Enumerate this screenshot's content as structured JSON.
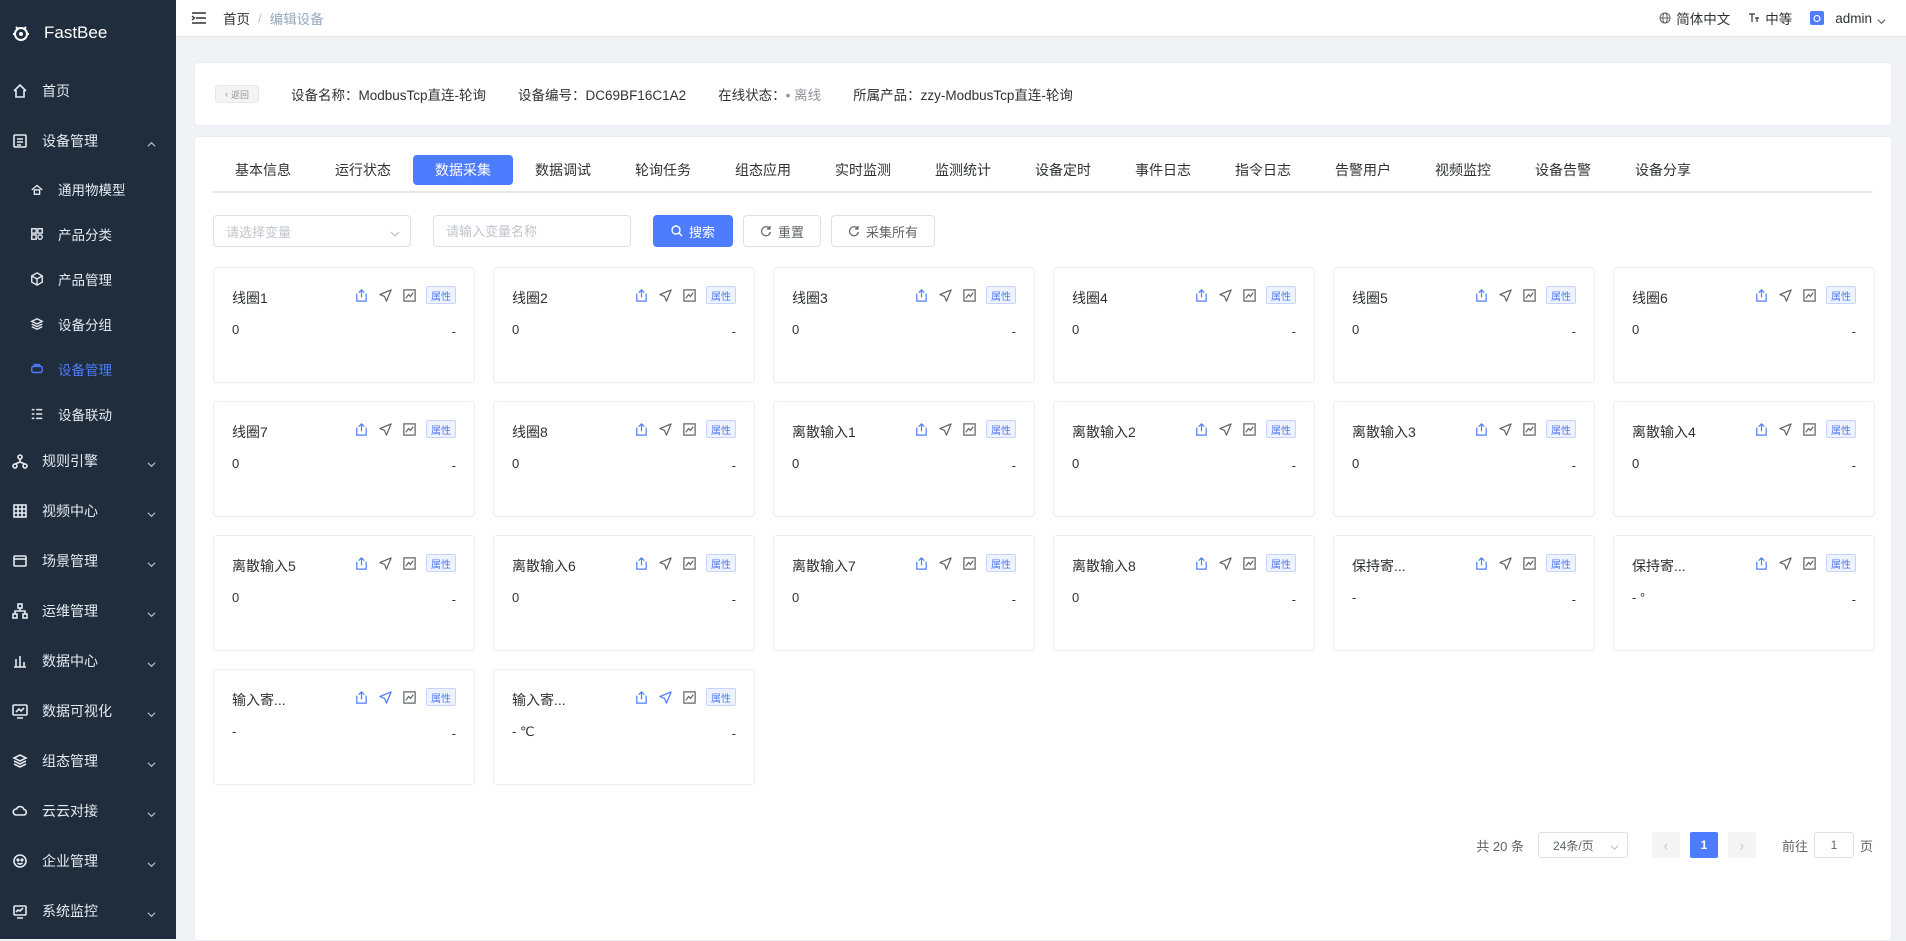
{
  "app": {
    "name": "FastBee"
  },
  "sidebar": {
    "items": [
      {
        "label": "首页",
        "icon": "home-icon",
        "expandable": false
      },
      {
        "label": "设备管理",
        "icon": "list-icon",
        "expandable": true,
        "expanded": true,
        "children": [
          {
            "label": "通用物模型",
            "icon": "model-icon",
            "active": false
          },
          {
            "label": "产品分类",
            "icon": "category-icon",
            "active": false
          },
          {
            "label": "产品管理",
            "icon": "cube-icon",
            "active": false
          },
          {
            "label": "设备分组",
            "icon": "layers-icon",
            "active": false
          },
          {
            "label": "设备管理",
            "icon": "device-icon",
            "active": true
          },
          {
            "label": "设备联动",
            "icon": "linkage-icon",
            "active": false
          }
        ]
      },
      {
        "label": "规则引擎",
        "icon": "rule-icon",
        "expandable": true
      },
      {
        "label": "视频中心",
        "icon": "grid-icon",
        "expandable": true
      },
      {
        "label": "场景管理",
        "icon": "scene-icon",
        "expandable": true
      },
      {
        "label": "运维管理",
        "icon": "tree-icon",
        "expandable": true
      },
      {
        "label": "数据中心",
        "icon": "bar-chart-icon",
        "expandable": true
      },
      {
        "label": "数据可视化",
        "icon": "dashboard-icon",
        "expandable": true
      },
      {
        "label": "组态管理",
        "icon": "stack-icon",
        "expandable": true
      },
      {
        "label": "云云对接",
        "icon": "cloud-icon",
        "expandable": true
      },
      {
        "label": "企业管理",
        "icon": "enterprise-icon",
        "expandable": true
      },
      {
        "label": "系统监控",
        "icon": "monitor-icon",
        "expandable": true
      }
    ]
  },
  "topbar": {
    "breadcrumb": {
      "home": "首页",
      "separator": "/",
      "current": "编辑设备"
    },
    "language": "简体中文",
    "size": "中等",
    "user": "admin"
  },
  "device": {
    "back_label": "返回",
    "name_label": "设备名称：",
    "name": "ModbusTcp直连-轮询",
    "sn_label": "设备编号：",
    "sn": "DC69BF16C1A2",
    "status_label": "在线状态：",
    "status_dot": "•",
    "status": "离线",
    "product_label": "所属产品：",
    "product": "zzy-ModbusTcp直连-轮询"
  },
  "tabs": [
    {
      "label": "基本信息",
      "active": false
    },
    {
      "label": "运行状态",
      "active": false
    },
    {
      "label": "数据采集",
      "active": true
    },
    {
      "label": "数据调试",
      "active": false
    },
    {
      "label": "轮询任务",
      "active": false
    },
    {
      "label": "组态应用",
      "active": false
    },
    {
      "label": "实时监测",
      "active": false
    },
    {
      "label": "监测统计",
      "active": false
    },
    {
      "label": "设备定时",
      "active": false
    },
    {
      "label": "事件日志",
      "active": false
    },
    {
      "label": "指令日志",
      "active": false
    },
    {
      "label": "告警用户",
      "active": false
    },
    {
      "label": "视频监控",
      "active": false
    },
    {
      "label": "设备告警",
      "active": false
    },
    {
      "label": "设备分享",
      "active": false
    }
  ],
  "filters": {
    "select_placeholder": "请选择变量",
    "input_placeholder": "请输入变量名称",
    "search_label": "搜索",
    "reset_label": "重置",
    "collect_all_label": "采集所有"
  },
  "tag_label": "属性",
  "variables": [
    {
      "name": "线圈1",
      "value": "0",
      "unit": "-",
      "send_active": false
    },
    {
      "name": "线圈2",
      "value": "0",
      "unit": "-",
      "send_active": false
    },
    {
      "name": "线圈3",
      "value": "0",
      "unit": "-",
      "send_active": false
    },
    {
      "name": "线圈4",
      "value": "0",
      "unit": "-",
      "send_active": false
    },
    {
      "name": "线圈5",
      "value": "0",
      "unit": "-",
      "send_active": false
    },
    {
      "name": "线圈6",
      "value": "0",
      "unit": "-",
      "send_active": false
    },
    {
      "name": "线圈7",
      "value": "0",
      "unit": "-",
      "send_active": false
    },
    {
      "name": "线圈8",
      "value": "0",
      "unit": "-",
      "send_active": false
    },
    {
      "name": "离散输入1",
      "value": "0",
      "unit": "-",
      "send_active": false
    },
    {
      "name": "离散输入2",
      "value": "0",
      "unit": "-",
      "send_active": false
    },
    {
      "name": "离散输入3",
      "value": "0",
      "unit": "-",
      "send_active": false
    },
    {
      "name": "离散输入4",
      "value": "0",
      "unit": "-",
      "send_active": false
    },
    {
      "name": "离散输入5",
      "value": "0",
      "unit": "-",
      "send_active": false
    },
    {
      "name": "离散输入6",
      "value": "0",
      "unit": "-",
      "send_active": false
    },
    {
      "name": "离散输入7",
      "value": "0",
      "unit": "-",
      "send_active": false
    },
    {
      "name": "离散输入8",
      "value": "0",
      "unit": "-",
      "send_active": false
    },
    {
      "name": "保持寄...",
      "value": "-",
      "unit": "-",
      "send_active": false
    },
    {
      "name": "保持寄...",
      "value": "- °",
      "unit": "-",
      "send_active": false
    },
    {
      "name": "输入寄...",
      "value": "-",
      "unit": "-",
      "send_active": true
    },
    {
      "name": "输入寄...",
      "value": "- ℃",
      "unit": "-",
      "send_active": true
    }
  ],
  "pagination": {
    "total_text": "共 20 条",
    "page_size": "24条/页",
    "current_page": "1",
    "goto_label": "前往",
    "goto_value": "1",
    "page_suffix": "页"
  },
  "colors": {
    "primary": "#4d7cfe",
    "sidebar_bg": "#1f2d3d"
  }
}
